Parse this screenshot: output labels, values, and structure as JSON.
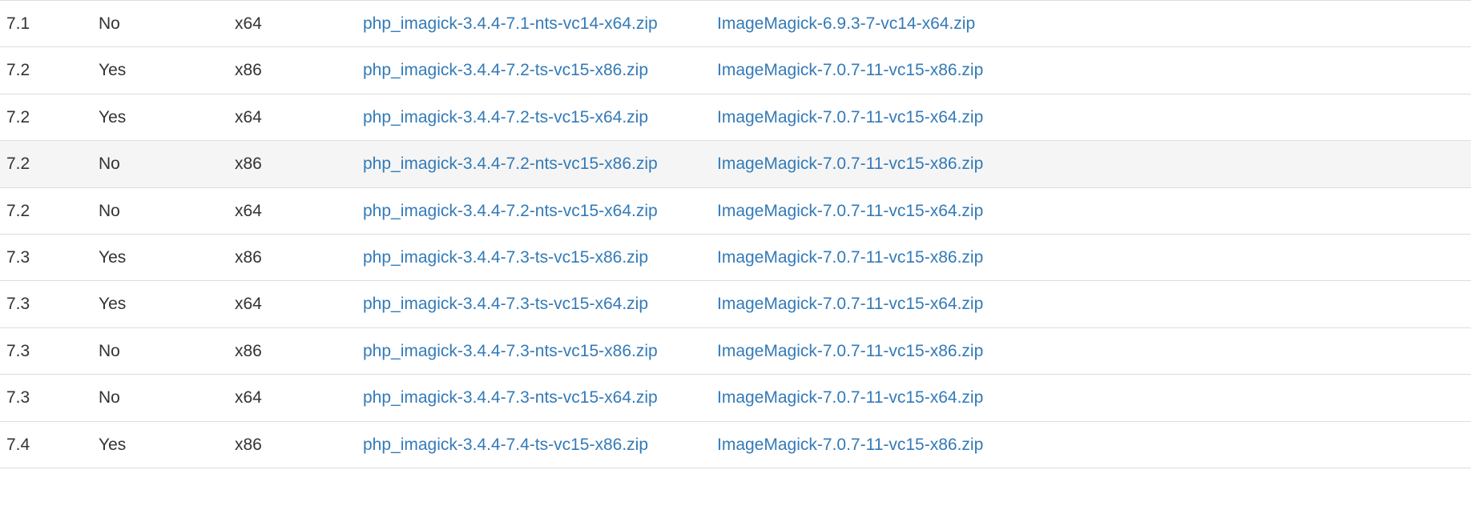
{
  "rows": [
    {
      "version": "7.1",
      "thread_safe": "No",
      "arch": "x64",
      "ext": "php_imagick-3.4.4-7.1-nts-vc14-x64.zip",
      "im": "ImageMagick-6.9.3-7-vc14-x64.zip",
      "hovered": false
    },
    {
      "version": "7.2",
      "thread_safe": "Yes",
      "arch": "x86",
      "ext": "php_imagick-3.4.4-7.2-ts-vc15-x86.zip",
      "im": "ImageMagick-7.0.7-11-vc15-x86.zip",
      "hovered": false
    },
    {
      "version": "7.2",
      "thread_safe": "Yes",
      "arch": "x64",
      "ext": "php_imagick-3.4.4-7.2-ts-vc15-x64.zip",
      "im": "ImageMagick-7.0.7-11-vc15-x64.zip",
      "hovered": false
    },
    {
      "version": "7.2",
      "thread_safe": "No",
      "arch": "x86",
      "ext": "php_imagick-3.4.4-7.2-nts-vc15-x86.zip",
      "im": "ImageMagick-7.0.7-11-vc15-x86.zip",
      "hovered": true
    },
    {
      "version": "7.2",
      "thread_safe": "No",
      "arch": "x64",
      "ext": "php_imagick-3.4.4-7.2-nts-vc15-x64.zip",
      "im": "ImageMagick-7.0.7-11-vc15-x64.zip",
      "hovered": false
    },
    {
      "version": "7.3",
      "thread_safe": "Yes",
      "arch": "x86",
      "ext": "php_imagick-3.4.4-7.3-ts-vc15-x86.zip",
      "im": "ImageMagick-7.0.7-11-vc15-x86.zip",
      "hovered": false
    },
    {
      "version": "7.3",
      "thread_safe": "Yes",
      "arch": "x64",
      "ext": "php_imagick-3.4.4-7.3-ts-vc15-x64.zip",
      "im": "ImageMagick-7.0.7-11-vc15-x64.zip",
      "hovered": false
    },
    {
      "version": "7.3",
      "thread_safe": "No",
      "arch": "x86",
      "ext": "php_imagick-3.4.4-7.3-nts-vc15-x86.zip",
      "im": "ImageMagick-7.0.7-11-vc15-x86.zip",
      "hovered": false
    },
    {
      "version": "7.3",
      "thread_safe": "No",
      "arch": "x64",
      "ext": "php_imagick-3.4.4-7.3-nts-vc15-x64.zip",
      "im": "ImageMagick-7.0.7-11-vc15-x64.zip",
      "hovered": false
    },
    {
      "version": "7.4",
      "thread_safe": "Yes",
      "arch": "x86",
      "ext": "php_imagick-3.4.4-7.4-ts-vc15-x86.zip",
      "im": "ImageMagick-7.0.7-11-vc15-x86.zip",
      "hovered": false
    }
  ]
}
